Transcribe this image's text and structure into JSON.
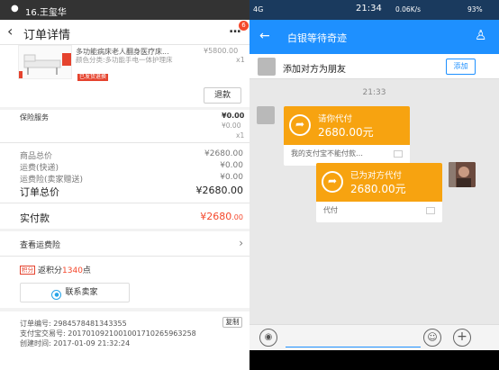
{
  "left": {
    "status_title": "16.王玺华",
    "nav": {
      "back": "‹",
      "title": "订单详情",
      "more": "...",
      "badge": "6"
    },
    "product": {
      "name": "多功能病床老人翻身医疗床...",
      "spec": "颜色分类:多功能手电一体护理床",
      "tag": "已发货退换",
      "price": "¥5800.00",
      "qty": "x1"
    },
    "refund_label": "退款",
    "insurance": {
      "label": "保险服务",
      "price": "¥0.00",
      "price2": "¥0.00",
      "qty": "x1"
    },
    "summary": [
      {
        "label": "商品总价",
        "value": "¥2680.00"
      },
      {
        "label": "运费(快递)",
        "value": "¥0.00"
      },
      {
        "label": "运费险(卖家赠送)",
        "value": "¥0.00"
      }
    ],
    "total": {
      "label": "订单总价",
      "value": "¥2680.00"
    },
    "paid": {
      "label": "实付款",
      "value": "¥2680",
      "cents": ".00"
    },
    "shipping_insurance": "查看运费险",
    "points": {
      "tag": "积分",
      "prefix": "返积分",
      "num": "1340",
      "suffix": "点"
    },
    "contact_label": "联系卖家",
    "order_no": "订单编号: 2984578481343355",
    "trade_no": "支付宝交易号: 2017010921001001710265963258",
    "created": "创建时间: 2017-01-09 21:32:24",
    "copy_label": "复制"
  },
  "right": {
    "status": {
      "signal": "4G",
      "time": "21:34",
      "speed": "0.06K/s",
      "battery": "93%"
    },
    "nav": {
      "title": "白银等待奇迹"
    },
    "friend_bar": {
      "text": "添加对方为朋友",
      "add_label": "添加"
    },
    "chat_time": "21:33",
    "msg1": {
      "title": "请你代付",
      "amount": "2680.00元",
      "foot": "我的支付宝不能付款…"
    },
    "msg2": {
      "title": "已为对方代付",
      "amount": "2680.00元",
      "foot": "代付"
    }
  },
  "colors": {
    "orange": "#f7a310",
    "blue": "#1e90ff",
    "red": "#f5482c"
  }
}
